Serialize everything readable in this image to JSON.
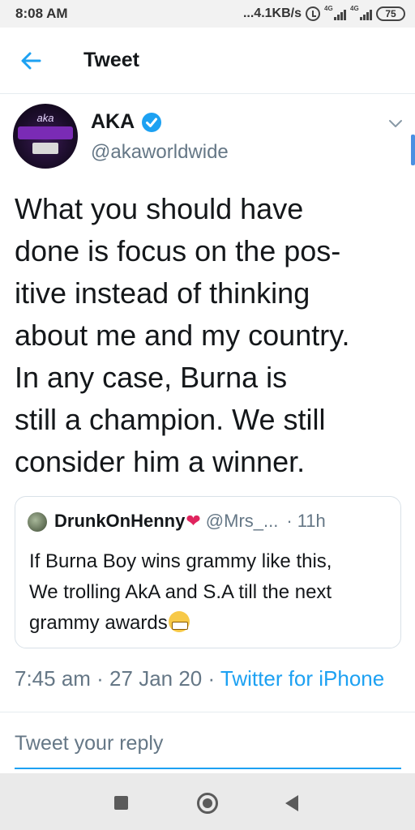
{
  "status_bar": {
    "time": "8:08 AM",
    "net_speed": "...4.1KB/s",
    "signal1_label": "4G",
    "signal2_label": "4G",
    "battery": "75"
  },
  "header": {
    "title": "Tweet",
    "back_icon": "arrow-left-icon"
  },
  "tweet": {
    "author_name": "AKA",
    "author_handle": "@akaworldwide",
    "verified": true,
    "avatar_text": "aka",
    "text": "What you should have\ndone is focus on the pos-\nitive instead of thinking\nabout me and my country.\nIn any case, Burna is\nstill a champion. We still\nconsider him a winner.",
    "timestamp": "7:45 am · 27 Jan 20 · ",
    "source": "Twitter for iPhone"
  },
  "quote": {
    "name": "DrunkOnHenny",
    "heart": "❤",
    "handle": "@Mrs_...",
    "dot": "·",
    "time": "11h",
    "text": "If Burna Boy wins grammy like this,\nWe trolling AkA and S.A till the next\ngrammy awards"
  },
  "reply": {
    "placeholder": "Tweet your reply"
  },
  "colors": {
    "accent": "#1da1f2",
    "secondary_text": "#657786",
    "heart": "#e0245e"
  }
}
